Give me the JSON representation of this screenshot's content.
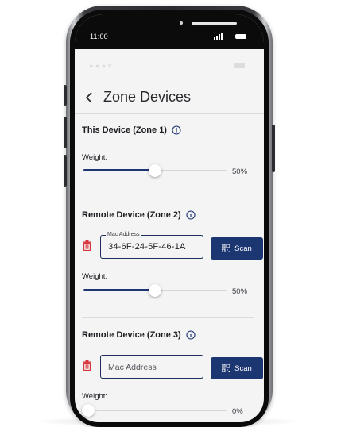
{
  "status_bar": {
    "time": "11:00"
  },
  "header": {
    "title": "Zone Devices",
    "back_icon": "chevron-left-icon"
  },
  "zones": [
    {
      "title": "This Device (Zone 1)",
      "weight_label": "Weight:",
      "weight_percent": 50,
      "weight_text": "50%"
    },
    {
      "title": "Remote Device (Zone 2)",
      "mac_label": "Mac Address",
      "mac_value": "34-6F-24-5F-46-1A",
      "scan_label": "Scan",
      "weight_label": "Weight:",
      "weight_percent": 50,
      "weight_text": "50%"
    },
    {
      "title": "Remote Device (Zone 3)",
      "mac_placeholder": "Mac Address",
      "mac_value": "",
      "scan_label": "Scan",
      "weight_label": "Weight:",
      "weight_percent": 0,
      "weight_text": "0%"
    }
  ],
  "colors": {
    "accent": "#1c3672",
    "delete": "#d9333b",
    "background": "#f4f4f5"
  }
}
